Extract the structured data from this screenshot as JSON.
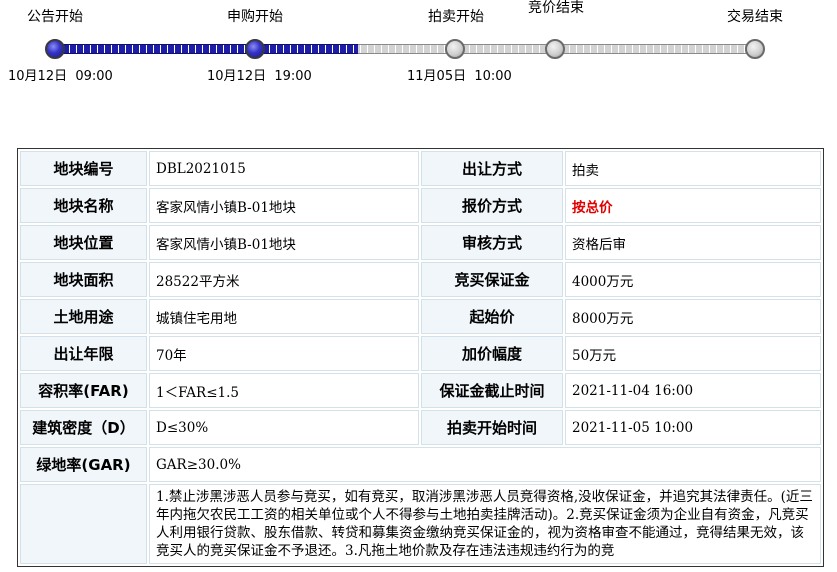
{
  "timeline": {
    "stages": [
      {
        "label": "公告开始",
        "date": "10月12日  09:00",
        "status": "done"
      },
      {
        "label": "申购开始",
        "date": "10月12日  19:00",
        "status": "done"
      },
      {
        "label": "拍卖开始",
        "date": "11月05日  10:00",
        "status": "todo"
      },
      {
        "label": "竞价结束",
        "date": "",
        "status": "todo"
      },
      {
        "label": "交易结束",
        "date": "",
        "status": "todo"
      }
    ],
    "colors": {
      "done": "#1d1da7",
      "todo": "#d3d3d3"
    }
  },
  "table": {
    "rows": [
      [
        {
          "k": "地块编号",
          "v": "DBL2021015"
        },
        {
          "k": "出让方式",
          "v": "拍卖"
        }
      ],
      [
        {
          "k": "地块名称",
          "v": "客家风情小镇B-01地块"
        },
        {
          "k": "报价方式",
          "v": "按总价",
          "highlight": true
        }
      ],
      [
        {
          "k": "地块位置",
          "v": "客家风情小镇B-01地块"
        },
        {
          "k": "审核方式",
          "v": "资格后审"
        }
      ],
      [
        {
          "k": "地块面积",
          "v": "28522平方米"
        },
        {
          "k": "竞买保证金",
          "v": "4000万元"
        }
      ],
      [
        {
          "k": "土地用途",
          "v": "城镇住宅用地"
        },
        {
          "k": "起始价",
          "v": "8000万元"
        }
      ],
      [
        {
          "k": "出让年限",
          "v": "70年"
        },
        {
          "k": "加价幅度",
          "v": "50万元"
        }
      ],
      [
        {
          "k": "容积率(FAR)",
          "v": "1＜FAR≤1.5"
        },
        {
          "k": "保证金截止时间",
          "v": "2021-11-04 16:00"
        }
      ],
      [
        {
          "k": "建筑密度（D）",
          "v": "D≤30%"
        },
        {
          "k": "拍卖开始时间",
          "v": "2021-11-05 10:00"
        }
      ],
      [
        {
          "k": "绿地率(GAR)",
          "v": "GAR≥30.0%"
        }
      ]
    ],
    "notes": "1.禁止涉黑涉恶人员参与竞买，如有竞买，取消涉黑涉恶人员竞得资格,没收保证金，并追究其法律责任。(近三年内拖欠农民工工资的相关单位或个人不得参与土地拍卖挂牌活动)。2.竞买保证金须为企业自有资金，凡竞买人利用银行贷款、股东借款、转贷和募集资金缴纳竞买保证金的，视为资格审查不能通过，竞得结果无效，该竞买人的竞买保证金不予退还。3.凡拖土地价款及存在违法违规违约行为的竞",
    "highlight_color": "#e00000"
  }
}
